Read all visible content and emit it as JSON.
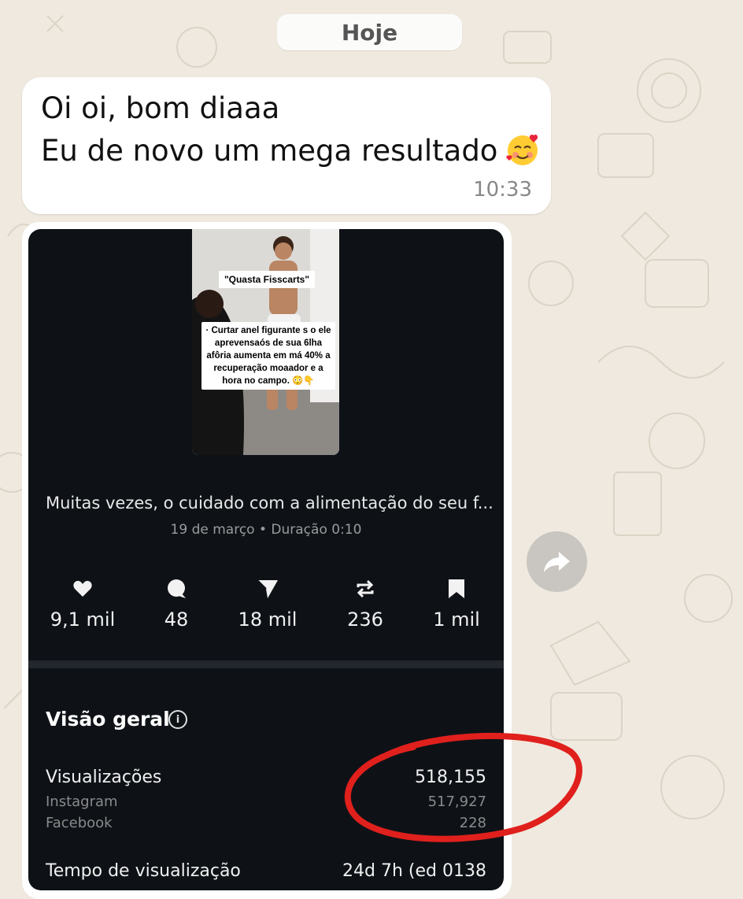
{
  "chat": {
    "date_pill": "Hoje",
    "message": {
      "line1": "Oi oi, bom diaaa",
      "line2": "Eu de novo um mega resultado",
      "emoji": "smiling-face-with-hearts",
      "time": "10:33"
    }
  },
  "post": {
    "thumbnail": {
      "title": "\"Quasta Fisscarts\"",
      "caption": "· Curtar anel figurante s o ele aprevensaós de sua 6lha afôria aumenta em má 40% a recuperação moaador e a hora no campo. 😳👇"
    },
    "caption": "Muitas vezes, o cuidado com a alimentação do seu f...",
    "meta": "19 de março • Duração 0:10",
    "stats": [
      {
        "icon": "heart-icon",
        "value": "9,1 mil"
      },
      {
        "icon": "comment-icon",
        "value": "48"
      },
      {
        "icon": "send-icon",
        "value": "18 mil"
      },
      {
        "icon": "repost-icon",
        "value": "236"
      },
      {
        "icon": "bookmark-icon",
        "value": "1 mil"
      }
    ],
    "overview": {
      "title": "Visão geral",
      "rows": [
        {
          "label": "Visualizações",
          "value": "518,155"
        },
        {
          "label": "Instagram",
          "value": "517,927"
        },
        {
          "label": "Facebook",
          "value": "228"
        },
        {
          "label": "Tempo de visualização",
          "value": "24d 7h (ed 0138"
        }
      ]
    }
  },
  "colors": {
    "chat_background": "#efe9df",
    "card_background": "#0e1217",
    "annotation": "#e0201c"
  }
}
